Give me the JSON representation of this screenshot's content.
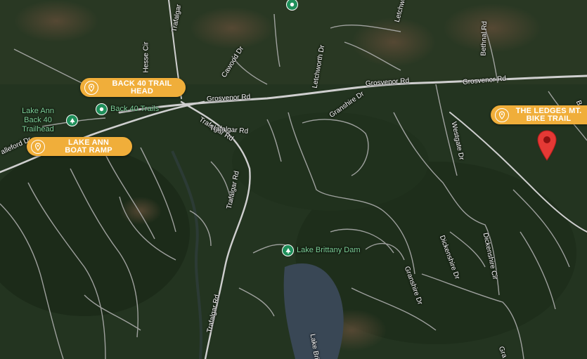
{
  "colors": {
    "forest": "#263a22",
    "road": "#c9c9c9",
    "water": "#3a4a58",
    "callout": "#f0ae3a",
    "poi_green": "#1f8f5a",
    "poi_label": "#7fd39a",
    "marker_red": "#e53935"
  },
  "callouts": {
    "back40": {
      "label": "BACK 40 TRAIL HEAD",
      "icon": "map-pin-icon"
    },
    "boatramp": {
      "label": "LAKE ANN BOAT RAMP",
      "icon": "map-pin-icon"
    },
    "ledges": {
      "label": "THE LEDGES MT. BIKE TRAIL",
      "icon": "map-pin-icon"
    }
  },
  "pois": {
    "lake_ann_back40": {
      "label": "Lake Ann Back 40 Trailhead",
      "icon": "tree-icon"
    },
    "back40_trails": {
      "label": "Back 40 Trails",
      "icon": "location-pin-icon"
    },
    "lake_brittany_dam": {
      "label": "Lake Brittany Dam",
      "icon": "tree-icon"
    },
    "top_poi": {
      "label": "",
      "icon": "location-pin-icon"
    }
  },
  "roads": {
    "grosvenor_w": "Grosvenor Rd",
    "grosvenor_m": "Grosvenor Rd",
    "grosvenor_e": "Grosvenor Rd",
    "trafalgar_n": "Trafalgar Rd",
    "trafalgar_m": "Trafalgar Rd",
    "trafalgar_s": "Trafalgar Rd",
    "trafalgar_w": "Trafalgar Rd",
    "hesse": "Hesse Cir",
    "trafalgar_top": "Trafalgar",
    "cawood": "Cawood Dr",
    "letchworth": "Letchworth Dr",
    "letchwo": "Letchwo",
    "bethnal": "Bethnal Rd",
    "bet": "Bet",
    "granshire": "Granshire Dr",
    "granshire_s": "Granshire Dr",
    "westgate": "Westgate Dr",
    "dickenshire_dr": "Dickenshire Dr",
    "dickenshire_cir": "Dickenshire Cir",
    "alleford": "alleford Dr",
    "lake_britt": "Lake Britt",
    "gra": "Gra"
  },
  "marker": {
    "icon": "red-location-marker-icon"
  }
}
